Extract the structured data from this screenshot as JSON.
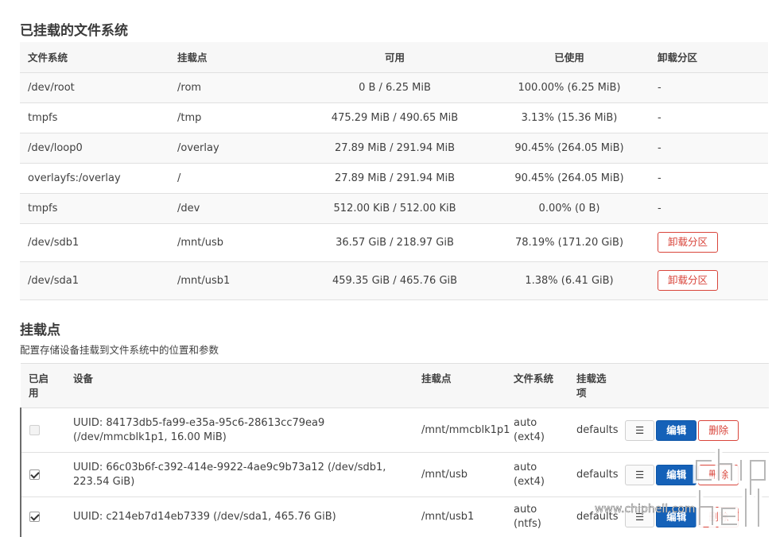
{
  "filesystems": {
    "title": "已挂载的文件系统",
    "headers": [
      "文件系统",
      "挂载点",
      "可用",
      "已使用",
      "卸载分区"
    ],
    "rows": [
      {
        "fs": "/dev/root",
        "mount": "/rom",
        "avail": "0 B / 6.25 MiB",
        "used": "100.00% (6.25 MiB)",
        "unmount": "-"
      },
      {
        "fs": "tmpfs",
        "mount": "/tmp",
        "avail": "475.29 MiB / 490.65 MiB",
        "used": "3.13% (15.36 MiB)",
        "unmount": "-"
      },
      {
        "fs": "/dev/loop0",
        "mount": "/overlay",
        "avail": "27.89 MiB / 291.94 MiB",
        "used": "90.45% (264.05 MiB)",
        "unmount": "-"
      },
      {
        "fs": "overlayfs:/overlay",
        "mount": "/",
        "avail": "27.89 MiB / 291.94 MiB",
        "used": "90.45% (264.05 MiB)",
        "unmount": "-"
      },
      {
        "fs": "tmpfs",
        "mount": "/dev",
        "avail": "512.00 KiB / 512.00 KiB",
        "used": "0.00% (0 B)",
        "unmount": "-"
      },
      {
        "fs": "/dev/sdb1",
        "mount": "/mnt/usb",
        "avail": "36.57 GiB / 218.97 GiB",
        "used": "78.19% (171.20 GiB)",
        "unmount_button": "卸载分区"
      },
      {
        "fs": "/dev/sda1",
        "mount": "/mnt/usb1",
        "avail": "459.35 GiB / 465.76 GiB",
        "used": "1.38% (6.41 GiB)",
        "unmount_button": "卸载分区"
      }
    ]
  },
  "mountpoints": {
    "title": "挂载点",
    "description": "配置存储设备挂载到文件系统中的位置和参数",
    "headers": [
      "已启用",
      "设备",
      "挂载点",
      "文件系统",
      "挂载选项"
    ],
    "buttons": {
      "menu": "☰",
      "edit": "编辑",
      "delete": "删除"
    },
    "rows": [
      {
        "enabled": false,
        "device": "UUID: 84173db5-fa99-e35a-95c6-28613cc79ea9 (/dev/mmcblk1p1, 16.00 MiB)",
        "mount": "/mnt/mmcblk1p1",
        "fs": "auto (ext4)",
        "options": "defaults"
      },
      {
        "enabled": true,
        "device": "UUID: 66c03b6f-c392-414e-9922-4ae9c9b73a12 (/dev/sdb1, 223.54 GiB)",
        "mount": "/mnt/usb",
        "fs": "auto (ext4)",
        "options": "defaults"
      },
      {
        "enabled": true,
        "device": "UUID: c214eb7d14eb7339 (/dev/sda1, 465.76 GiB)",
        "mount": "/mnt/usb1",
        "fs": "auto (ntfs)",
        "options": "defaults"
      }
    ]
  },
  "watermark": {
    "text": "www.chiphell.com",
    "logo_text": "chip hell"
  }
}
